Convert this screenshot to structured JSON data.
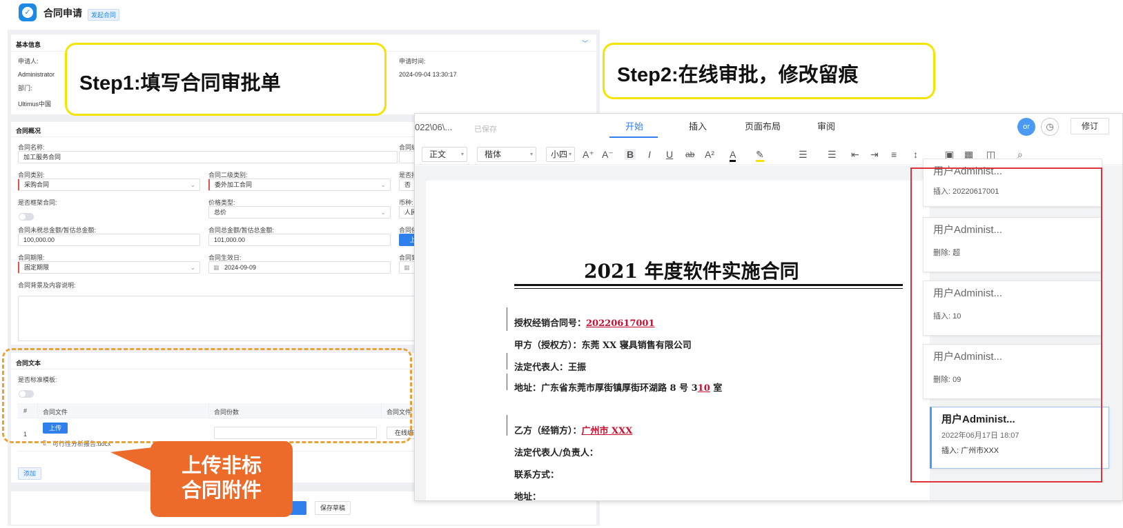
{
  "header": {
    "title": "合同申请",
    "tag": "发起合同",
    "logo_icon": "check-circle-icon"
  },
  "basic_info": {
    "section_title": "基本信息",
    "applicant_label": "申请人:",
    "applicant_value": "Administrator",
    "dept_label": "部门:",
    "dept_value": "Ultimus中国",
    "apply_time_label": "申请时间:",
    "apply_time_value": "2024-09-04 13:30:17"
  },
  "overview": {
    "section_title": "合同概况",
    "name_label": "合同名称:",
    "name_value": "加工服务合同",
    "name_right_label": "合同编",
    "type_label": "合同类别:",
    "type_value": "采购合同",
    "subtype_label": "合同二级类别:",
    "subtype_value": "委外加工合同",
    "right_label_2": "是否招",
    "right_value_2": "否",
    "framework_label": "是否框架合同:",
    "price_type_label": "价格类型:",
    "price_type_value": "总价",
    "currency_label": "币种:",
    "currency_value": "人民",
    "untaxed_label": "合同未税总金额/暂估总金额:",
    "untaxed_value": "100,000.00",
    "total_label": "合同总金额/暂估总金额:",
    "total_value": "101,000.00",
    "right_label_4": "合同依",
    "upload_short": "上",
    "term_label": "合同期限:",
    "term_value": "固定期限",
    "effective_label": "合同生效日:",
    "effective_value": "2024-09-09",
    "right_label_5": "合同到",
    "desc_label": "合同背景及内容说明:"
  },
  "contract_text": {
    "section_title": "合同文本",
    "standard_label": "是否标准模板:",
    "columns": [
      "#",
      "合同文件",
      "合同份数",
      "合同文件"
    ],
    "row_index": "1",
    "upload_label": "上传",
    "file_name": "可行性分析报告.docx",
    "right_cell": "在线编辑",
    "add_label": "添加"
  },
  "footer": {
    "save_draft_label": "保存草稿"
  },
  "callouts": {
    "step1": "Step1:填写合同审批单",
    "step2": "Step2:在线审批，修改留痕",
    "orange_line1": "上传非标",
    "orange_line2": "合同附件"
  },
  "editor": {
    "doc_crumb": "022\\06\\...",
    "saved_label": "已保存",
    "tabs": [
      "开始",
      "插入",
      "页面布局",
      "审阅"
    ],
    "active_tab": "开始",
    "avatar_text": "or",
    "revise_label": "修订",
    "style_value": "正文",
    "font_value": "楷体",
    "size_value": "小四",
    "doc_title": "2021 年度软件实施合同",
    "lines": {
      "l1_prefix": "授权经销合同号：",
      "l1_value": "20220617001",
      "l2": "甲方（授权方）：东莞 XX 寝具销售有限公司",
      "l3": "法定代表人：王振",
      "l4_prefix": "地址：广东省东莞市厚街镇厚街环湖路 8 号 3",
      "l4_red": "10",
      "l4_suffix": " 室",
      "l5_prefix": "乙方（经销方）：",
      "l5_value": "广州市 XXX",
      "l6": "法定代表人/负责人：",
      "l7": "联系方式：",
      "l8": "地址："
    },
    "comments": [
      {
        "user": "用户Administ...",
        "action": "插入: 20220617001"
      },
      {
        "user": "用户Administ...",
        "action": "删除: 超"
      },
      {
        "user": "用户Administ...",
        "action": "插入: 10"
      },
      {
        "user": "用户Administ...",
        "action": "删除: 09"
      },
      {
        "user": "用户Administ...",
        "time": "2022年06月17日 18:07",
        "action": "插入: 广州市XXX"
      }
    ]
  },
  "colors": {
    "accent": "#2f7ef6",
    "callout_yellow": "#f5e400",
    "callout_orange": "#ec6b2a",
    "revision_red": "#c8102e",
    "highlight_box": "#e0303a"
  }
}
